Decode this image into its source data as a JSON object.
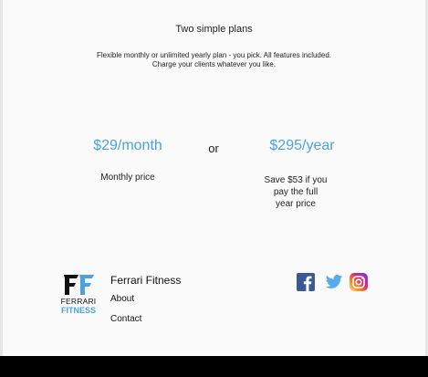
{
  "pricing": {
    "heading": "Two simple plans",
    "subtitle_line1": "Flexible monthly or unlimited yearly plan - you pick. All features included.",
    "subtitle_line2": "Charge your clients whatever you like.",
    "monthly": {
      "price": "$29/month",
      "description": "Monthly price"
    },
    "separator": "or",
    "yearly": {
      "price": "$295/year",
      "description_line1": "Save $53 if you",
      "description_line2": "pay the full",
      "description_line3": "year price"
    }
  },
  "footer": {
    "logo": {
      "word1": "FERRARI",
      "word2": "FITNESS",
      "icon": "ff-monogram-logo"
    },
    "brand_name": "Ferrari Fitness",
    "links": [
      "About",
      "Contact"
    ],
    "social": [
      {
        "name": "facebook-icon",
        "color": "#3b5998"
      },
      {
        "name": "twitter-icon",
        "color": "#55acee"
      },
      {
        "name": "instagram-icon",
        "color": "#c13584"
      }
    ]
  },
  "colors": {
    "accent": "#4aa3df",
    "bottom_bar": "#000000",
    "background": "#fafafa"
  }
}
